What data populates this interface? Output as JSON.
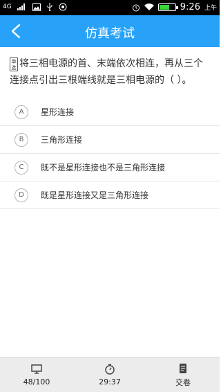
{
  "status_bar": {
    "network": "4G",
    "time": "9:26",
    "ampm": "上午"
  },
  "app_bar": {
    "title": "仿真考试"
  },
  "question": {
    "type_badge": "单选",
    "text": "将三相电源的首、末端依次相连，再从三个连接点引出三根端线就是三相电源的（ ）。"
  },
  "options": [
    {
      "letter": "A",
      "text": "星形连接"
    },
    {
      "letter": "B",
      "text": "三角形连接"
    },
    {
      "letter": "C",
      "text": "既不是星形连接也不是三角形连接"
    },
    {
      "letter": "D",
      "text": "既是星形连接又是三角形连接"
    }
  ],
  "bottom_bar": {
    "progress": "48/100",
    "timer": "29:37",
    "submit_label": "交卷"
  },
  "colors": {
    "accent": "#27a2f8"
  }
}
